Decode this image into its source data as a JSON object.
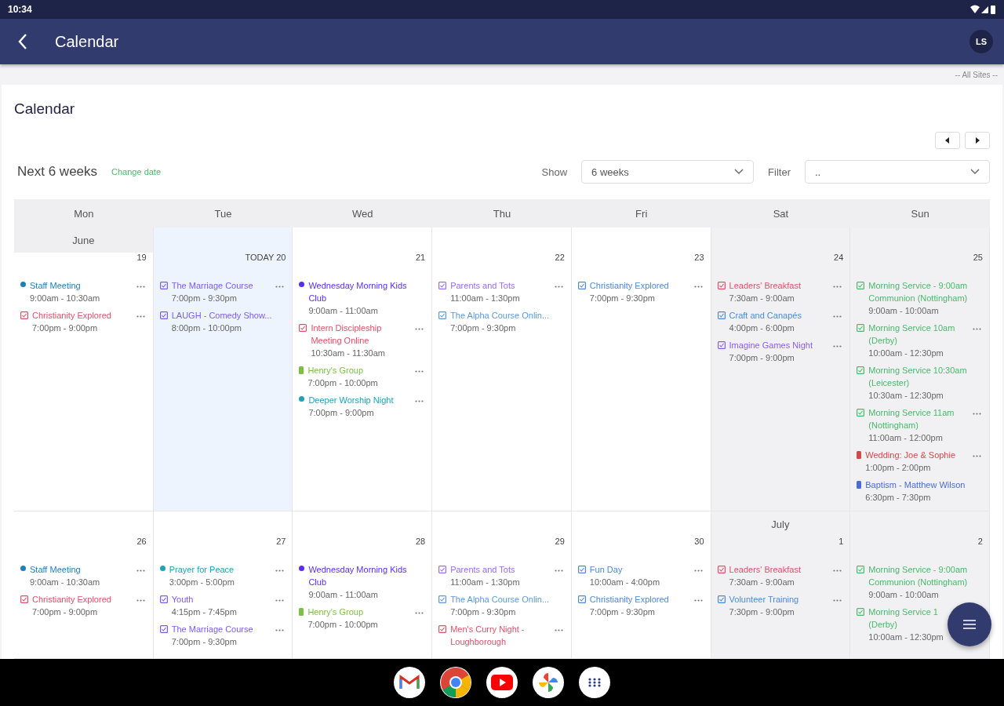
{
  "status_bar": {
    "time": "10:34"
  },
  "app_bar": {
    "title": "Calendar",
    "avatar": "LS"
  },
  "site_selector": "-- All Sites --",
  "page": {
    "title": "Calendar",
    "range": "Next 6 weeks",
    "change_date": "Change date"
  },
  "controls": {
    "show_label": "Show",
    "show_value": "6 weeks",
    "filter_label": "Filter",
    "filter_value": ".."
  },
  "weekdays": [
    "Mon",
    "Tue",
    "Wed",
    "Thu",
    "Fri",
    "Sat",
    "Sun"
  ],
  "weeks": [
    {
      "days": [
        {
          "month": "June",
          "date": "19",
          "today": false,
          "weekend": false,
          "events": [
            {
              "kind": "dot",
              "color": "#1f7fb8",
              "title": "Staff Meeting",
              "time": "9:00am - 10:30am",
              "more": true
            },
            {
              "kind": "box",
              "color": "#e0506a",
              "title": "Christianity Explored",
              "time": "7:00pm - 9:00pm",
              "more": true
            }
          ]
        },
        {
          "date": "TODAY 20",
          "today": true,
          "weekend": false,
          "events": [
            {
              "kind": "box",
              "color": "#7b5cf0",
              "title": "The Marriage Course",
              "time": "7:00pm - 9:30pm",
              "more": true
            },
            {
              "kind": "box",
              "color": "#7b5cf0",
              "title": "LAUGH - Comedy Show...",
              "time": "8:00pm - 10:00pm",
              "more": false
            }
          ]
        },
        {
          "date": "21",
          "today": false,
          "weekend": false,
          "events": [
            {
              "kind": "dot",
              "color": "#5a2ef0",
              "title": "Wednesday Morning Kids Club",
              "time": "9:00am - 11:00am",
              "more": false
            },
            {
              "kind": "box",
              "color": "#e0506a",
              "title": "Intern Discipleship Meeting Online",
              "time": "10:30am - 11:30am",
              "more": true
            },
            {
              "kind": "pill",
              "color": "#7ac043",
              "title": "Henry's Group",
              "time": "7:00pm - 10:00pm",
              "more": true
            },
            {
              "kind": "dot",
              "color": "#1fa3b8",
              "title": "Deeper Worship Night",
              "time": "7:00pm - 9:00pm",
              "more": true
            }
          ]
        },
        {
          "date": "22",
          "today": false,
          "weekend": false,
          "events": [
            {
              "kind": "box",
              "color": "#9a6cf0",
              "title": "Parents and Tots",
              "time": "11:00am - 1:30pm",
              "more": true
            },
            {
              "kind": "box",
              "color": "#5a9ad8",
              "title": "The Alpha Course Onlin...",
              "time": "7:00pm - 9:30pm",
              "more": false
            }
          ]
        },
        {
          "date": "23",
          "today": false,
          "weekend": false,
          "events": [
            {
              "kind": "box",
              "color": "#4a8ad8",
              "title": "Christianity Explored",
              "time": "7:00pm - 9:30pm",
              "more": true
            }
          ]
        },
        {
          "date": "24",
          "today": false,
          "weekend": true,
          "events": [
            {
              "kind": "box",
              "color": "#e0506a",
              "title": "Leaders' Breakfast",
              "time": "7:30am - 9:00am",
              "more": true
            },
            {
              "kind": "box",
              "color": "#4a8ad8",
              "title": "Craft and Canapés",
              "time": "4:00pm - 6:00pm",
              "more": true
            },
            {
              "kind": "box",
              "color": "#8a5cf0",
              "title": "Imagine Games Night",
              "time": "7:00pm - 9:00pm",
              "more": true
            }
          ]
        },
        {
          "date": "25",
          "today": false,
          "weekend": true,
          "events": [
            {
              "kind": "box",
              "color": "#4cb86a",
              "title": "Morning Service - 9:00am Communion (Nottingham)",
              "time": "9:00am - 10:00am",
              "more": false
            },
            {
              "kind": "box",
              "color": "#4cb86a",
              "title": "Morning Service 10am (Derby)",
              "time": "10:00am - 12:30pm",
              "more": true
            },
            {
              "kind": "box",
              "color": "#4cb86a",
              "title": "Morning Service 10:30am (Leicester)",
              "time": "10:30am - 12:30pm",
              "more": false
            },
            {
              "kind": "box",
              "color": "#4cb86a",
              "title": "Morning Service 11am (Nottingham)",
              "time": "11:00am - 12:00pm",
              "more": true
            },
            {
              "kind": "pill",
              "color": "#d04a4a",
              "title": "Wedding: Joe & Sophie",
              "time": "1:00pm - 2:00pm",
              "more": true
            },
            {
              "kind": "pill",
              "color": "#4a6ad8",
              "title": "Baptism - Matthew Wilson",
              "time": "6:30pm - 7:30pm",
              "more": false
            }
          ]
        }
      ]
    },
    {
      "days": [
        {
          "date": "26",
          "today": false,
          "weekend": false,
          "events": [
            {
              "kind": "dot",
              "color": "#1f7fb8",
              "title": "Staff Meeting",
              "time": "9:00am - 10:30am",
              "more": true
            },
            {
              "kind": "box",
              "color": "#e0506a",
              "title": "Christianity Explored",
              "time": "7:00pm - 9:00pm",
              "more": true
            }
          ]
        },
        {
          "date": "27",
          "today": false,
          "weekend": false,
          "events": [
            {
              "kind": "dot",
              "color": "#1fa3b8",
              "title": "Prayer for Peace",
              "time": "3:00pm - 5:00pm",
              "more": true
            },
            {
              "kind": "box",
              "color": "#7b5cf0",
              "title": "Youth",
              "time": "4:15pm - 7:45pm",
              "more": true
            },
            {
              "kind": "box",
              "color": "#7b5cf0",
              "title": "The Marriage Course",
              "time": "7:00pm - 9:30pm",
              "more": true
            }
          ]
        },
        {
          "date": "28",
          "today": false,
          "weekend": false,
          "events": [
            {
              "kind": "dot",
              "color": "#5a2ef0",
              "title": "Wednesday Morning Kids Club",
              "time": "9:00am - 11:00am",
              "more": false
            },
            {
              "kind": "pill",
              "color": "#7ac043",
              "title": "Henry's Group",
              "time": "7:00pm - 10:00pm",
              "more": true
            }
          ]
        },
        {
          "date": "29",
          "today": false,
          "weekend": false,
          "events": [
            {
              "kind": "box",
              "color": "#9a6cf0",
              "title": "Parents and Tots",
              "time": "11:00am - 1:30pm",
              "more": true
            },
            {
              "kind": "box",
              "color": "#5a9ad8",
              "title": "The Alpha Course Onlin...",
              "time": "7:00pm - 9:30pm",
              "more": false
            },
            {
              "kind": "box",
              "color": "#e0506a",
              "title": "Men's Curry Night - Loughborough",
              "more": true
            }
          ]
        },
        {
          "date": "30",
          "today": false,
          "weekend": false,
          "events": [
            {
              "kind": "box",
              "color": "#4a8ad8",
              "title": "Fun Day",
              "time": "10:00am - 4:00pm",
              "more": true
            },
            {
              "kind": "box",
              "color": "#4a8ad8",
              "title": "Christianity Explored",
              "time": "7:00pm - 9:30pm",
              "more": true
            }
          ]
        },
        {
          "month": "July",
          "date": "1",
          "today": false,
          "weekend": true,
          "events": [
            {
              "kind": "box",
              "color": "#e0506a",
              "title": "Leaders' Breakfast",
              "time": "7:30am - 9:00am",
              "more": true
            },
            {
              "kind": "box",
              "color": "#4a8ad8",
              "title": "Volunteer Training",
              "time": "7:30pm - 9:00pm",
              "more": true
            }
          ]
        },
        {
          "date": "2",
          "today": false,
          "weekend": true,
          "events": [
            {
              "kind": "box",
              "color": "#4cb86a",
              "title": "Morning Service - 9:00am Communion (Nottingham)",
              "time": "9:00am - 10:00am",
              "more": false
            },
            {
              "kind": "box",
              "color": "#4cb86a",
              "title": "Morning Service 1",
              "title_cont": "(Derby)",
              "time": "10:00am - 12:30pm",
              "more": false
            }
          ]
        }
      ]
    }
  ]
}
